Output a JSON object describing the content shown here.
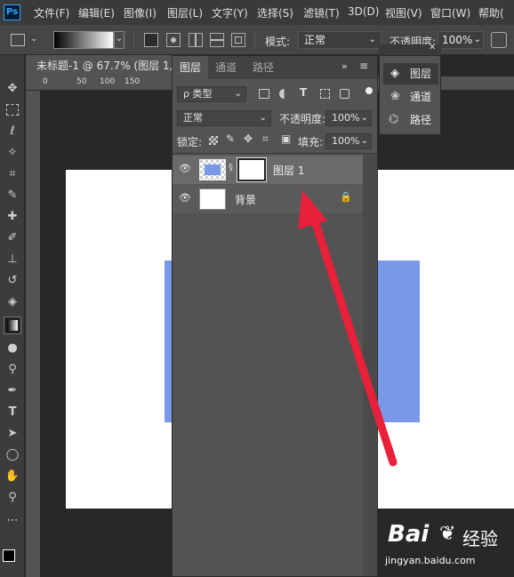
{
  "menubar": {
    "logo": "Ps",
    "items": [
      "文件(F)",
      "编辑(E)",
      "图像(I)",
      "图层(L)",
      "文字(Y)",
      "选择(S)",
      "滤镜(T)",
      "3D(D)",
      "视图(V)",
      "窗口(W)",
      "帮助("
    ]
  },
  "options": {
    "mode_label": "模式:",
    "mode_value": "正常",
    "opacity_label": "不透明度:",
    "opacity_value": "100%"
  },
  "document": {
    "tab_title": "未标题-1 @ 67.7% (图层 1, 图",
    "ruler_ticks": [
      "0",
      "50",
      "100",
      "150"
    ]
  },
  "layers_panel": {
    "tabs": [
      "图层",
      "通道",
      "路径"
    ],
    "filter_label": "ρ 类型",
    "blend_mode": "正常",
    "opacity_label": "不透明度:",
    "opacity_value": "100%",
    "lock_label": "锁定:",
    "fill_label": "填充:",
    "fill_value": "100%",
    "layers": [
      {
        "name": "图层 1"
      },
      {
        "name": "背景"
      }
    ]
  },
  "mini_panel": {
    "items": [
      "图层",
      "通道",
      "路径"
    ]
  },
  "watermark": {
    "brand": "Bai",
    "brand2": "经验",
    "url": "jingyan.baidu.com"
  },
  "colors": {
    "accent_arrow": "#e8203a",
    "layer_fill": "#7799e8"
  }
}
